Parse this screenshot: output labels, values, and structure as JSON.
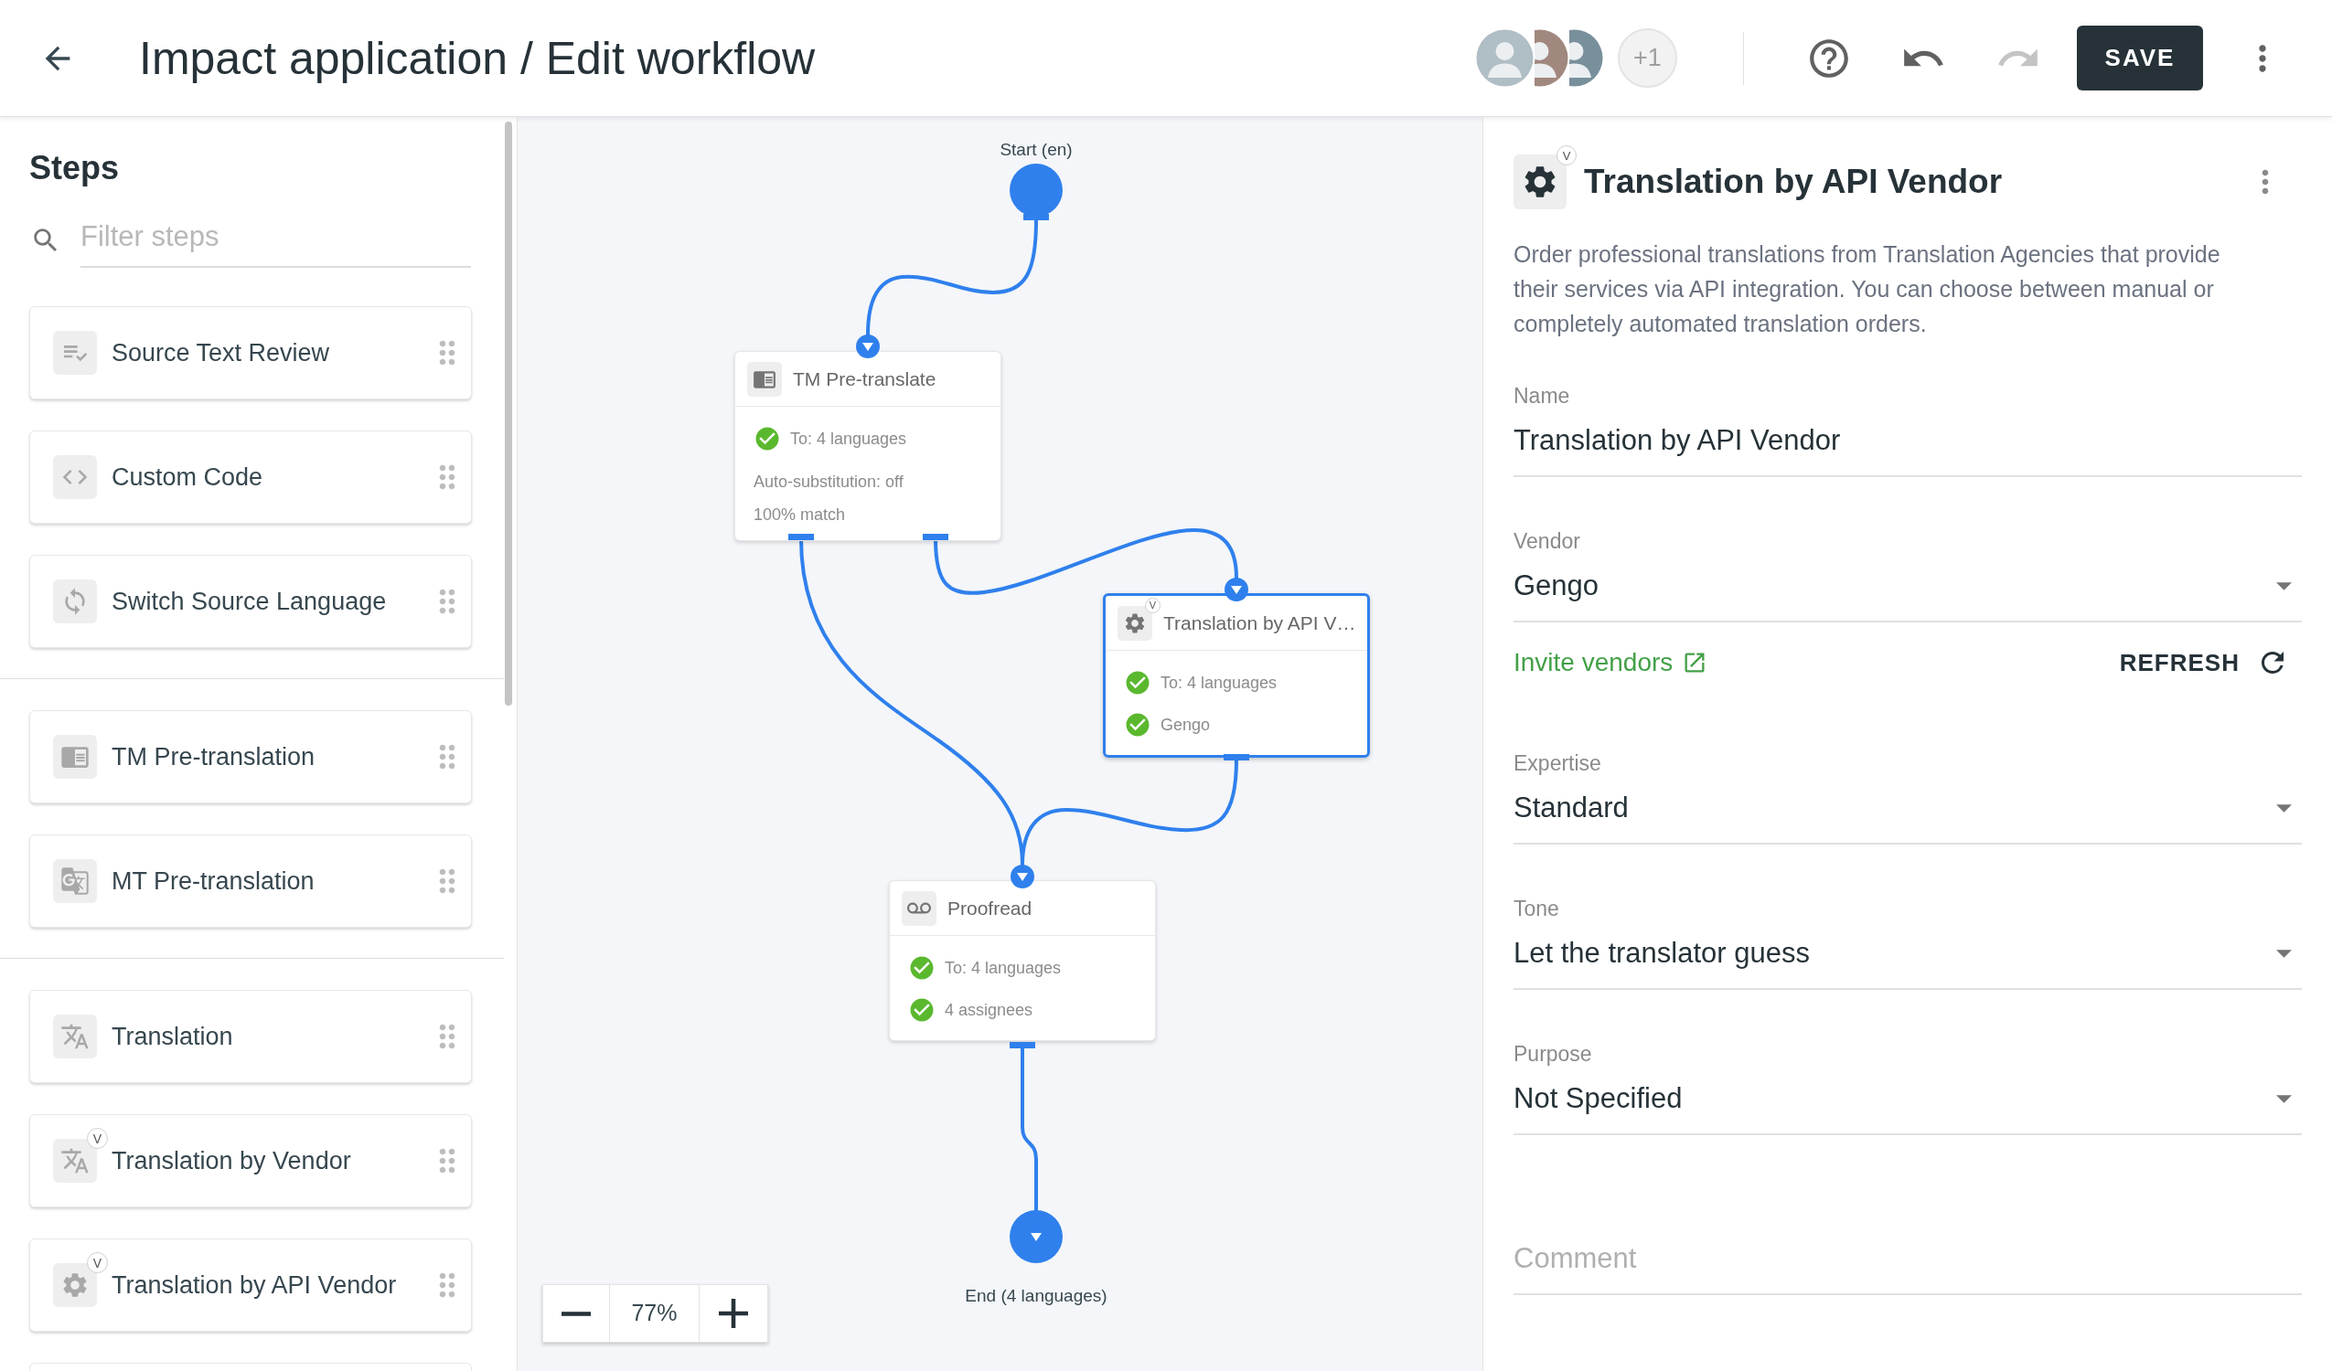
{
  "header": {
    "title": "Impact application / Edit workflow",
    "avatars": [
      {
        "kind": "photo"
      },
      {
        "kind": "photo"
      },
      {
        "kind": "photo"
      }
    ],
    "more_users": "+1",
    "undo": {
      "disabled": false
    },
    "redo": {
      "disabled": true
    },
    "save": "SAVE"
  },
  "steps": {
    "title": "Steps",
    "filter": {
      "placeholder": "Filter steps"
    },
    "groups": [
      {
        "items": [
          {
            "kind": "review",
            "label": "Source Text Review"
          },
          {
            "kind": "code",
            "label": "Custom Code"
          },
          {
            "kind": "switch",
            "label": "Switch Source Language"
          }
        ]
      },
      {
        "items": [
          {
            "kind": "tm",
            "label": "TM Pre-translation"
          },
          {
            "kind": "mt",
            "label": "MT Pre-translation"
          }
        ]
      },
      {
        "items": [
          {
            "kind": "translation",
            "label": "Translation"
          },
          {
            "kind": "translation",
            "label": "Translation by Vendor",
            "badge": "V"
          },
          {
            "kind": "api",
            "label": "Translation by API Vendor",
            "badge": "V"
          }
        ]
      }
    ]
  },
  "workflow": {
    "start": {
      "label": "Start (en)"
    },
    "nodes": [
      {
        "kind": "tm",
        "title": "TM Pre-translate",
        "selected": false,
        "details": [
          {
            "text": "To: 4 languages",
            "checked": true
          },
          {
            "text": "Auto-substitution: off",
            "checked": false
          },
          {
            "text": "100% match",
            "checked": false
          }
        ]
      },
      {
        "kind": "api",
        "title": "Translation by API V…",
        "badge": "V",
        "selected": true,
        "details": [
          {
            "text": "To: 4 languages",
            "checked": true
          },
          {
            "text": "Gengo",
            "checked": true
          }
        ]
      },
      {
        "kind": "proofread",
        "title": "Proofread",
        "selected": false,
        "details": [
          {
            "text": "To: 4 languages",
            "checked": true
          },
          {
            "text": "4 assignees",
            "checked": true
          }
        ]
      }
    ],
    "end": {
      "label": "End (4 languages)"
    },
    "zoom": {
      "value": "77%"
    }
  },
  "panel": {
    "kind": "api",
    "title": "Translation by API Vendor",
    "badge": "V",
    "description": "Order professional translations from Translation Agencies that provide their services via API integration. You can choose between manual or completely automated translation orders.",
    "fields": [
      {
        "kind": "text",
        "label": "Name",
        "value": "Translation by API Vendor"
      },
      {
        "kind": "select",
        "label": "Vendor",
        "value": "Gengo",
        "link": "Invite vendors",
        "action": "REFRESH"
      },
      {
        "kind": "select",
        "label": "Expertise",
        "value": "Standard"
      },
      {
        "kind": "select",
        "label": "Tone",
        "value": "Let the translator guess"
      },
      {
        "kind": "select",
        "label": "Purpose",
        "value": "Not Specified"
      },
      {
        "kind": "textarea",
        "placeholder": "Comment"
      }
    ]
  }
}
